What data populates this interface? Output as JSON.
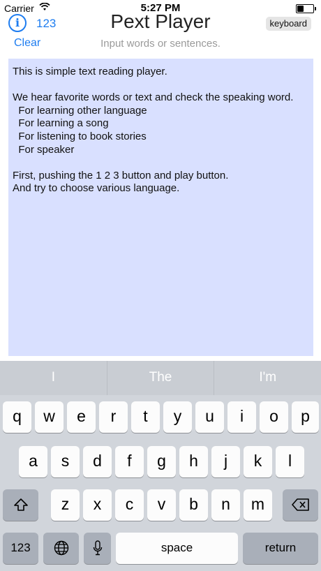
{
  "status_bar": {
    "carrier": "Carrier",
    "time": "5:27 PM"
  },
  "header": {
    "info_label": "i",
    "count_label": "123",
    "title": "Pext Player",
    "keyboard_label": "keyboard",
    "clear_label": "Clear",
    "subtitle": "Input words or sentences."
  },
  "editor": {
    "text": "This is simple text reading player.\n\nWe hear favorite words or text and check the speaking word.\n  For learning other language\n  For learning a song\n  For listening to book stories\n  For speaker\n\nFirst, pushing the 1 2 3 button and play button.\nAnd try to choose various language."
  },
  "keyboard": {
    "predictions": [
      "I",
      "The",
      "I'm"
    ],
    "row1": [
      "q",
      "w",
      "e",
      "r",
      "t",
      "y",
      "u",
      "i",
      "o",
      "p"
    ],
    "row2": [
      "a",
      "s",
      "d",
      "f",
      "g",
      "h",
      "j",
      "k",
      "l"
    ],
    "row3": [
      "z",
      "x",
      "c",
      "v",
      "b",
      "n",
      "m"
    ],
    "numbers_label": "123",
    "space_label": "space",
    "return_label": "return"
  }
}
